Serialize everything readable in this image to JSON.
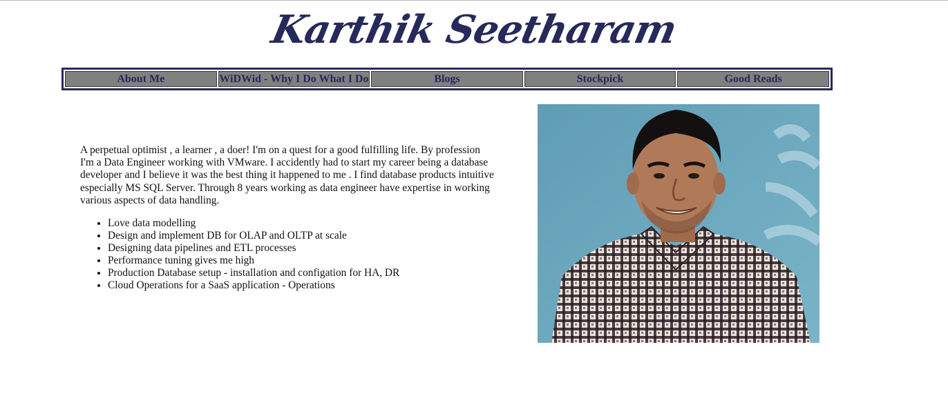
{
  "header": {
    "title": "Karthik Seetharam"
  },
  "nav": {
    "items": [
      {
        "label": "About Me"
      },
      {
        "label": "WiDWid - Why I Do What I Do"
      },
      {
        "label": "Blogs"
      },
      {
        "label": "Stockpick"
      },
      {
        "label": "Good Reads"
      }
    ]
  },
  "main": {
    "intro": "A perpetual optimist , a learner , a doer! I'm on a quest for a good fulfilling life. By profession I'm a Data Engineer working with VMware. I accidently had to start my career being a database developer and I believe it was the best thing it happened to me . I find database products intuitive especially MS SQL Server. Through 8 years working as data engineer have expertise in working various aspects of data handling.",
    "skills": [
      "Love data modelling",
      "Design and implement DB for OLAP and OLTP at scale",
      "Designing data pipelines and ETL processes",
      "Performance tuning gives me high",
      "Production Database setup - installation and configation for HA, DR",
      "Cloud Operations for a SaaS application - Operations"
    ]
  },
  "colors": {
    "brand_navy": "#26295a",
    "nav_gray": "#808080",
    "photo_background": "#6fa9c0"
  }
}
